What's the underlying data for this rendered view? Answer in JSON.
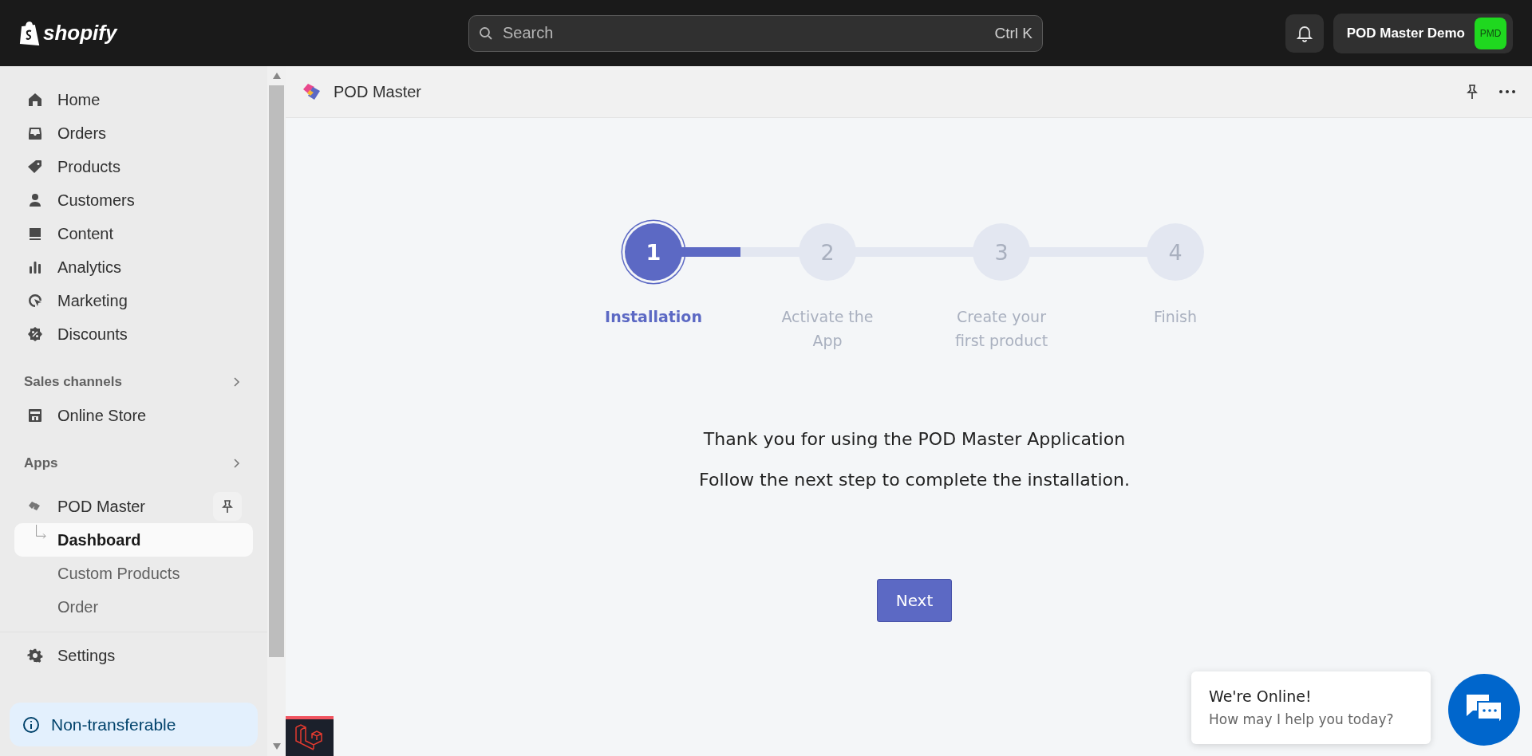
{
  "topbar": {
    "brand": "shopify",
    "search": {
      "placeholder": "Search",
      "shortcut": "Ctrl K"
    },
    "store": {
      "name": "POD Master Demo",
      "initials": "PMD"
    }
  },
  "sidebar": {
    "items": [
      {
        "label": "Home",
        "selected": false
      },
      {
        "label": "Orders",
        "selected": false
      },
      {
        "label": "Products",
        "selected": false
      },
      {
        "label": "Customers",
        "selected": false
      },
      {
        "label": "Content",
        "selected": false
      },
      {
        "label": "Analytics",
        "selected": false
      },
      {
        "label": "Marketing",
        "selected": false
      },
      {
        "label": "Discounts",
        "selected": false
      }
    ],
    "sales_channels": {
      "title": "Sales channels",
      "items": [
        {
          "label": "Online Store",
          "selected": false
        }
      ]
    },
    "apps": {
      "title": "Apps",
      "items": [
        {
          "label": "POD Master",
          "pinned": true,
          "children": [
            {
              "label": "Dashboard",
              "selected": true
            },
            {
              "label": "Custom Products",
              "selected": false
            },
            {
              "label": "Order",
              "selected": false
            }
          ]
        }
      ]
    },
    "settings": {
      "label": "Settings"
    },
    "notice": {
      "label": "Non-transferable"
    }
  },
  "app_header": {
    "title": "POD Master"
  },
  "stepper": {
    "steps": [
      {
        "number": "1",
        "label": "Installation",
        "selected": true,
        "level": 0.5
      },
      {
        "number": "2",
        "label": "Activate the App",
        "selected": false
      },
      {
        "number": "3",
        "label": "Create your first product",
        "selected": false
      },
      {
        "number": "4",
        "label": "Finish",
        "selected": false
      }
    ]
  },
  "message": {
    "lines": [
      "Thank you for using the POD Master Application",
      "Follow the next step to complete the installation."
    ]
  },
  "next_button": {
    "label": "Next"
  },
  "chat": {
    "title": "We're Online!",
    "subtitle": "How may I help you today?"
  }
}
